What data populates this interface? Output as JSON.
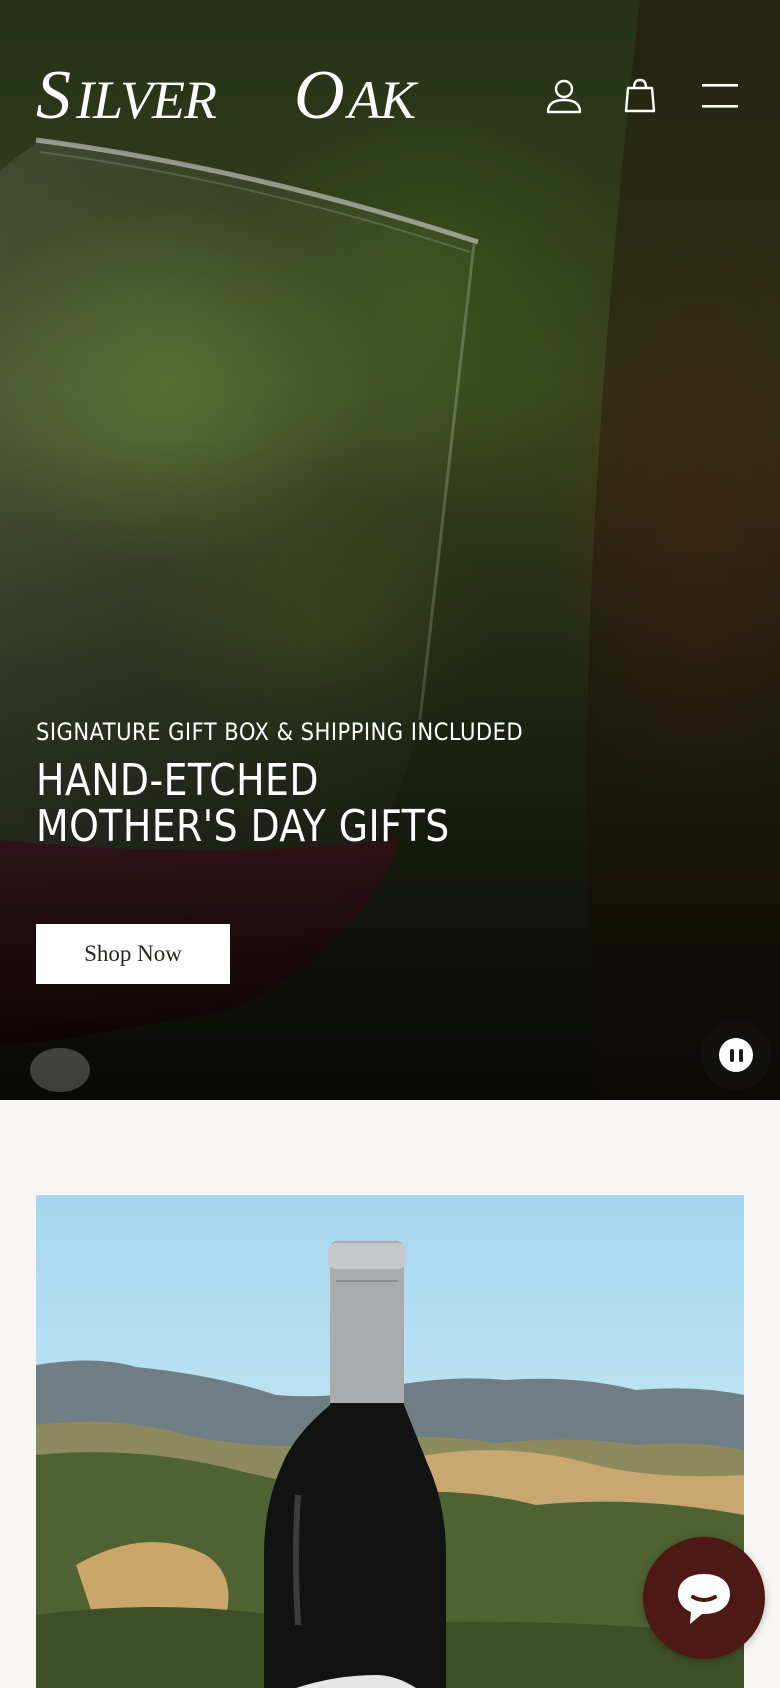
{
  "brand": {
    "logo_text": "SILVER OAK"
  },
  "header": {
    "icons": [
      "account-icon",
      "cart-icon",
      "menu-icon"
    ]
  },
  "hero": {
    "eyebrow": "SIGNATURE GIFT BOX & SHIPPING INCLUDED",
    "headline_line1": "HAND-ETCHED",
    "headline_line2": "MOTHER'S DAY GIFTS",
    "cta_label": "Shop Now",
    "media_control": "pause-icon"
  },
  "chat": {
    "icon": "chat-icon"
  },
  "colors": {
    "page_background": "#f8f6f2",
    "cta_background": "#ffffff",
    "chat_bubble": "#4e1814",
    "hero_text": "#ffffff"
  }
}
